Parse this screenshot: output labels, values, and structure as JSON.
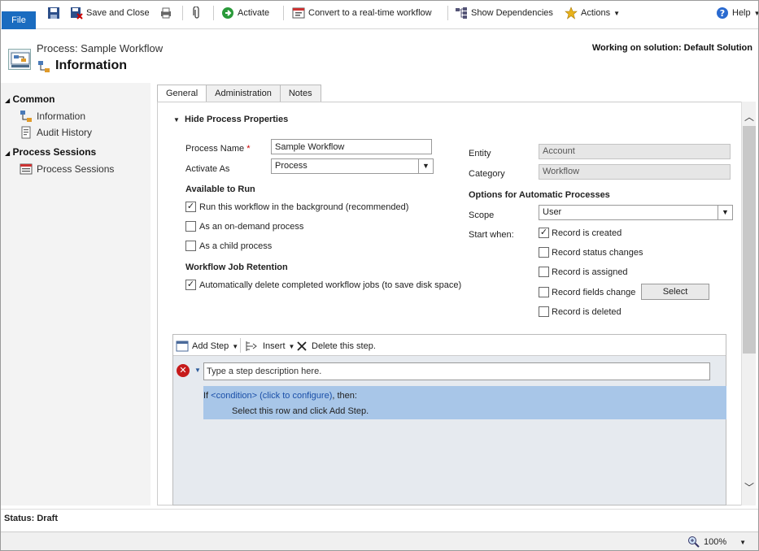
{
  "toolbar": {
    "file": "File",
    "save_close": "Save and Close",
    "activate": "Activate",
    "convert": "Convert to a real-time workflow",
    "show_dependencies": "Show Dependencies",
    "actions": "Actions",
    "help": "Help"
  },
  "header": {
    "process_label": "Process: Sample Workflow",
    "title": "Information",
    "solution": "Working on solution: Default Solution"
  },
  "nav": {
    "common": "Common",
    "information": "Information",
    "audit_history": "Audit History",
    "process_sessions_group": "Process Sessions",
    "process_sessions": "Process Sessions"
  },
  "tabs": [
    "General",
    "Administration",
    "Notes"
  ],
  "form": {
    "section_title": "Hide Process Properties",
    "process_name_label": "Process Name",
    "process_name_value": "Sample Workflow",
    "activate_as_label": "Activate As",
    "activate_as_value": "Process",
    "available_to_run": "Available to Run",
    "run_background": "Run this workflow in the background (recommended)",
    "on_demand": "As an on-demand process",
    "child_process": "As a child process",
    "retention": "Workflow Job Retention",
    "auto_delete": "Automatically delete completed workflow jobs (to save disk space)",
    "entity_label": "Entity",
    "entity_value": "Account",
    "category_label": "Category",
    "category_value": "Workflow",
    "options_title": "Options for Automatic Processes",
    "scope_label": "Scope",
    "scope_value": "User",
    "start_when_label": "Start when:",
    "record_created": "Record is created",
    "record_status": "Record status changes",
    "record_assigned": "Record is assigned",
    "record_fields": "Record fields change",
    "select_button": "Select",
    "record_deleted": "Record is deleted"
  },
  "steps": {
    "add_step": "Add Step",
    "insert": "Insert",
    "delete": "Delete this step.",
    "description_placeholder": "Type a step description here.",
    "if": "If ",
    "condition": "<condition> (click to configure)",
    "then": ", then:",
    "hint": "Select this row and click Add Step."
  },
  "status": {
    "text": "Status: Draft",
    "zoom": "100%"
  }
}
